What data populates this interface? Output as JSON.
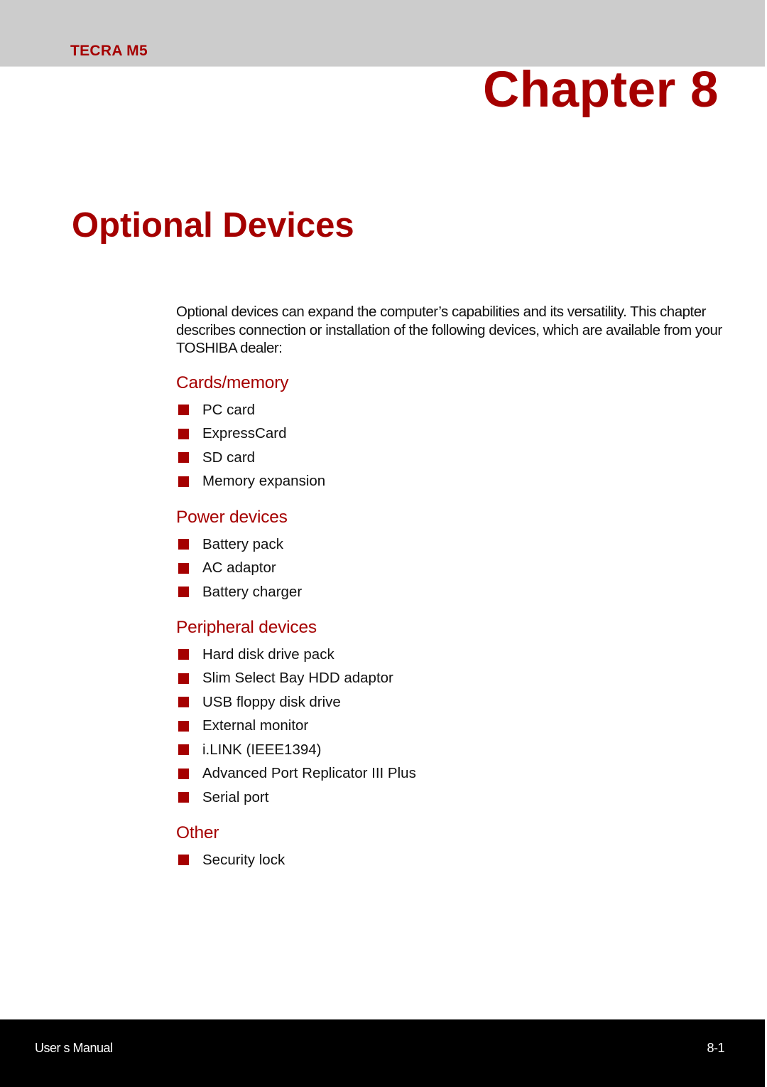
{
  "header": {
    "product": "TECRA M5",
    "chapter": "Chapter 8"
  },
  "page_title": "Optional Devices",
  "intro_text": "Optional devices can expand the computer’s capabilities and its versatility. This chapter describes connection or installation of the following devices, which are available from your TOSHIBA dealer:",
  "sections": [
    {
      "heading": "Cards/memory",
      "items": [
        "PC card",
        "ExpressCard",
        "SD card",
        "Memory expansion"
      ]
    },
    {
      "heading": "Power devices",
      "items": [
        "Battery pack",
        "AC adaptor",
        "Battery charger"
      ]
    },
    {
      "heading": "Peripheral devices",
      "items": [
        "Hard disk drive pack",
        "Slim Select Bay HDD adaptor",
        "USB floppy disk drive",
        "External monitor",
        "i.LINK (IEEE1394)",
        "Advanced Port Replicator III Plus",
        "Serial port"
      ]
    },
    {
      "heading": "Other",
      "items": [
        "Security lock"
      ]
    }
  ],
  "footer": {
    "label": "User s Manual",
    "page_number": "8-1"
  },
  "colors": {
    "accent": "#a50000",
    "header_band": "#cccccc",
    "footer_band": "#000000"
  }
}
